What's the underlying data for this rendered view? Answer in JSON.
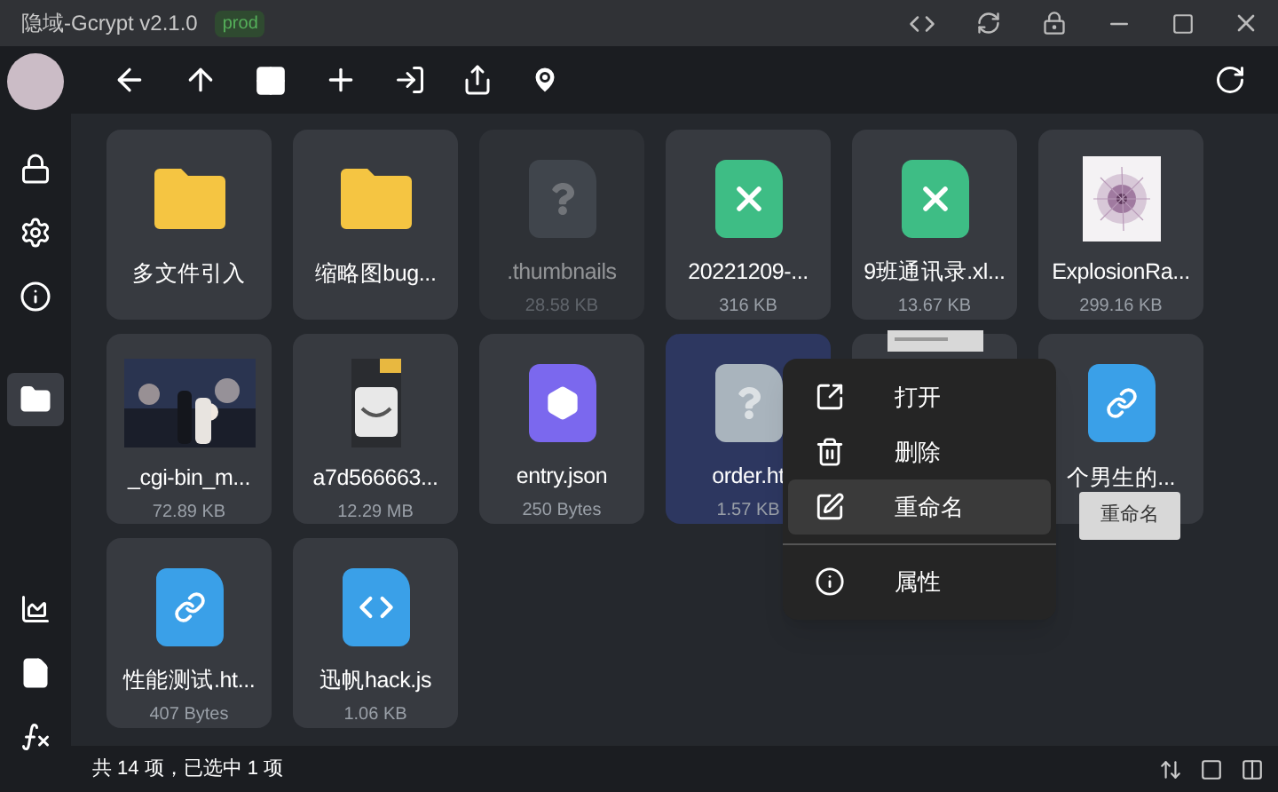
{
  "window": {
    "title": "隐域-Gcrypt v2.1.0",
    "badge": "prod"
  },
  "sidebar": {
    "items": [
      {
        "kind": "lock",
        "selected": false
      },
      {
        "kind": "settings",
        "selected": false
      },
      {
        "kind": "info",
        "selected": false
      },
      {
        "kind": "folder",
        "selected": true
      },
      {
        "kind": "chart",
        "selected": false
      },
      {
        "kind": "file",
        "selected": false
      },
      {
        "kind": "function",
        "selected": false
      }
    ]
  },
  "files": [
    {
      "kind": "folder",
      "name": "多文件引入",
      "selected": false,
      "hidden": false
    },
    {
      "kind": "folder",
      "name": "缩略图bug...",
      "selected": false,
      "hidden": false
    },
    {
      "kind": "unknown",
      "name": ".thumbnails",
      "size": "28.58 KB",
      "selected": false,
      "hidden": true
    },
    {
      "kind": "excel",
      "name": "20221209-...",
      "size": "316 KB",
      "selected": false,
      "hidden": false
    },
    {
      "kind": "excel",
      "name": "9班通讯录.xl...",
      "size": "13.67 KB",
      "selected": false,
      "hidden": false
    },
    {
      "kind": "burst",
      "name": "ExplosionRa...",
      "size": "299.16 KB",
      "selected": false,
      "hidden": false
    },
    {
      "name": "_cgi-bin_m...",
      "size": "72.89 KB",
      "selected": false,
      "hidden": false
    },
    {
      "kind": "bottle",
      "name": "a7d566663...",
      "size": "12.29 MB",
      "selected": false,
      "hidden": false
    },
    {
      "kind": "json",
      "name": "entry.json",
      "size": "250 Bytes",
      "selected": false,
      "hidden": false
    },
    {
      "kind": "unknown",
      "name": "order.ht",
      "size": "1.57 KB",
      "selected": true,
      "hidden": false
    },
    {
      "kind": "doc",
      "selected": false,
      "hidden": false
    },
    {
      "kind": "link",
      "name": "个男生的...",
      "selected": false,
      "hidden": false
    },
    {
      "kind": "link",
      "name": "性能测试.ht...",
      "size": "407 Bytes",
      "selected": false,
      "hidden": false
    },
    {
      "kind": "code",
      "name": "迅帆hack.js",
      "size": "1.06 KB",
      "selected": false,
      "hidden": false
    }
  ],
  "context_menu": {
    "items": [
      {
        "kind": "open",
        "label": "打开",
        "selected": false
      },
      {
        "kind": "delete",
        "label": "删除",
        "selected": false
      },
      {
        "kind": "rename",
        "label": "重命名",
        "selected": true
      },
      {
        "kind": "divider"
      },
      {
        "kind": "info",
        "label": "属性",
        "selected": false
      }
    ]
  },
  "tooltip": "重命名",
  "status_bar": {
    "text": "共 14 项，已选中 1 项"
  }
}
